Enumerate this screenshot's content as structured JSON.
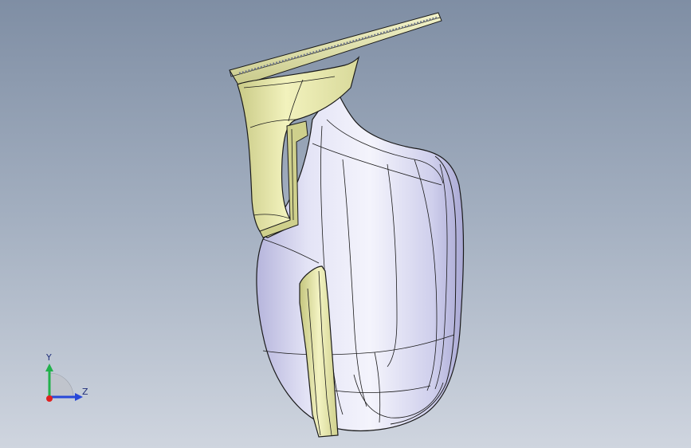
{
  "viewport": {
    "background_top": "#7f8ea4",
    "background_bottom": "#cfd5df"
  },
  "model": {
    "name": "mirror-housing",
    "body_color": "#dcdcf2",
    "body_shadow_color": "#b7b6dc",
    "accent_color": "#eeeeb0",
    "accent_shadow_color": "#c9ca84",
    "edge_color": "#1a1a1a"
  },
  "triad": {
    "y_label": "Y",
    "z_label": "Z",
    "y_color": "#22b14c",
    "z_color": "#2848d8",
    "x_color": "#e02020"
  }
}
